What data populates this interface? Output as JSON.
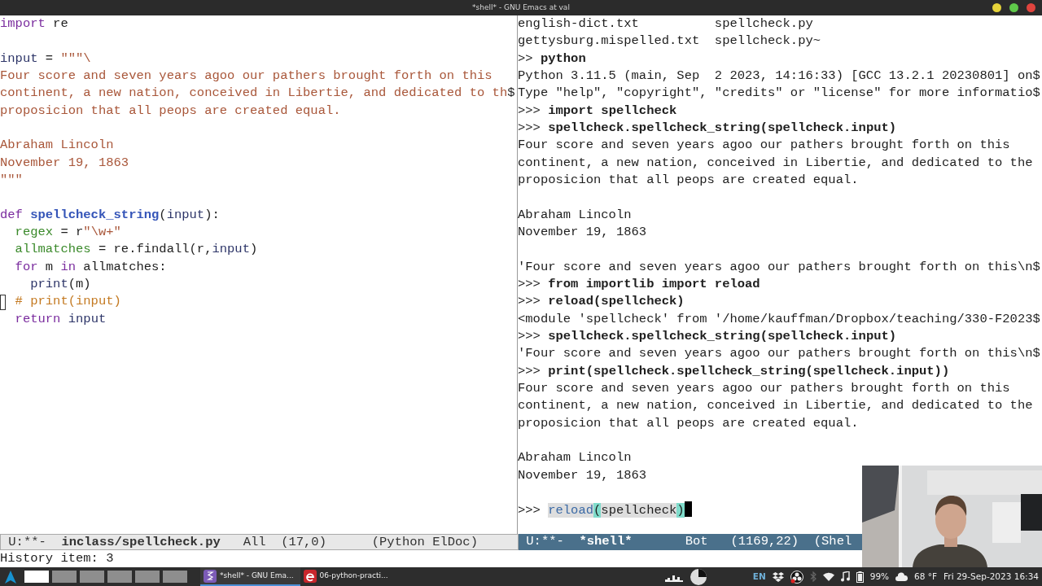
{
  "window": {
    "title": "*shell* - GNU Emacs at val",
    "buttons": [
      {
        "color": "#e6d33a"
      },
      {
        "color": "#5fc84a"
      },
      {
        "color": "#e0443e"
      }
    ]
  },
  "left_pane": {
    "lines": [
      {
        "kind": "code",
        "segments": [
          {
            "text": "import",
            "kind": "keyword"
          },
          {
            "text": " re",
            "kind": "plain"
          }
        ]
      },
      {
        "kind": "blank"
      },
      {
        "kind": "code",
        "segments": [
          {
            "text": "input",
            "kind": "name"
          },
          {
            "text": " = ",
            "kind": "plain"
          },
          {
            "text": "\"\"\"\\",
            "kind": "string"
          }
        ]
      },
      {
        "kind": "code",
        "segments": [
          {
            "text": "Four score and seven years agoo our pathers brought forth on this",
            "kind": "string"
          }
        ]
      },
      {
        "kind": "code",
        "segments": [
          {
            "text": "continent, a new nation, conceived in Libertie, and dedicated to th",
            "kind": "string"
          },
          {
            "text": "$",
            "kind": "plain"
          }
        ]
      },
      {
        "kind": "code",
        "segments": [
          {
            "text": "proposicion that all peops are created equal.",
            "kind": "string"
          }
        ]
      },
      {
        "kind": "blank"
      },
      {
        "kind": "code",
        "segments": [
          {
            "text": "Abraham Lincoln",
            "kind": "string"
          }
        ]
      },
      {
        "kind": "code",
        "segments": [
          {
            "text": "November 19, 1863",
            "kind": "string"
          }
        ]
      },
      {
        "kind": "code",
        "segments": [
          {
            "text": "\"\"\"",
            "kind": "string"
          }
        ]
      },
      {
        "kind": "blank"
      },
      {
        "kind": "code",
        "segments": [
          {
            "text": "def",
            "kind": "keyword"
          },
          {
            "text": " spellcheck_string",
            "kind": "func"
          },
          {
            "text": "(",
            "kind": "plain"
          },
          {
            "text": "input",
            "kind": "name"
          },
          {
            "text": "):",
            "kind": "plain"
          }
        ]
      },
      {
        "kind": "code",
        "segments": [
          {
            "text": "  regex",
            "kind": "var"
          },
          {
            "text": " = r",
            "kind": "plain"
          },
          {
            "text": "\"\\w+\"",
            "kind": "string"
          }
        ]
      },
      {
        "kind": "code",
        "segments": [
          {
            "text": "  allmatches",
            "kind": "var"
          },
          {
            "text": " = re.findall(r,",
            "kind": "plain"
          },
          {
            "text": "input",
            "kind": "name"
          },
          {
            "text": ")",
            "kind": "plain"
          }
        ]
      },
      {
        "kind": "code",
        "segments": [
          {
            "text": "  for",
            "kind": "keyword"
          },
          {
            "text": " m ",
            "kind": "plain"
          },
          {
            "text": "in",
            "kind": "keyword"
          },
          {
            "text": " allmatches:",
            "kind": "plain"
          }
        ]
      },
      {
        "kind": "code",
        "segments": [
          {
            "text": "    print",
            "kind": "name"
          },
          {
            "text": "(m)",
            "kind": "plain"
          }
        ]
      },
      {
        "kind": "code",
        "cursor": true,
        "segments": [
          {
            "text": "  # print(input)",
            "kind": "comment"
          }
        ]
      },
      {
        "kind": "code",
        "segments": [
          {
            "text": "  return",
            "kind": "keyword"
          },
          {
            "text": " input",
            "kind": "name"
          }
        ]
      }
    ]
  },
  "right_pane": {
    "lines": [
      {
        "kind": "code",
        "segments": [
          {
            "text": "english-dict.txt          spellcheck.py",
            "kind": "plain"
          }
        ]
      },
      {
        "kind": "code",
        "segments": [
          {
            "text": "gettysburg.mispelled.txt  spellcheck.py~",
            "kind": "plain"
          }
        ]
      },
      {
        "kind": "code",
        "segments": [
          {
            "text": ">> ",
            "kind": "plain"
          },
          {
            "text": "python",
            "kind": "bold"
          }
        ]
      },
      {
        "kind": "code",
        "segments": [
          {
            "text": "Python 3.11.5 (main, Sep  2 2023, 14:16:33) [GCC 13.2.1 20230801] on$",
            "kind": "plain"
          }
        ]
      },
      {
        "kind": "code",
        "segments": [
          {
            "text": "Type \"help\", \"copyright\", \"credits\" or \"license\" for more informatio$",
            "kind": "plain"
          }
        ]
      },
      {
        "kind": "code",
        "segments": [
          {
            "text": ">>> ",
            "kind": "plain"
          },
          {
            "text": "import spellcheck",
            "kind": "bold"
          }
        ]
      },
      {
        "kind": "code",
        "segments": [
          {
            "text": ">>> ",
            "kind": "plain"
          },
          {
            "text": "spellcheck.spellcheck_string(spellcheck.input)",
            "kind": "bold"
          }
        ]
      },
      {
        "kind": "code",
        "segments": [
          {
            "text": "Four score and seven years agoo our pathers brought forth on this",
            "kind": "plain"
          }
        ]
      },
      {
        "kind": "code",
        "segments": [
          {
            "text": "continent, a new nation, conceived in Libertie, and dedicated to the",
            "kind": "plain"
          }
        ]
      },
      {
        "kind": "code",
        "segments": [
          {
            "text": "proposicion that all peops are created equal.",
            "kind": "plain"
          }
        ]
      },
      {
        "kind": "blank"
      },
      {
        "kind": "code",
        "segments": [
          {
            "text": "Abraham Lincoln",
            "kind": "plain"
          }
        ]
      },
      {
        "kind": "code",
        "segments": [
          {
            "text": "November 19, 1863",
            "kind": "plain"
          }
        ]
      },
      {
        "kind": "blank"
      },
      {
        "kind": "code",
        "segments": [
          {
            "text": "'Four score and seven years agoo our pathers brought forth on this\\n$",
            "kind": "plain"
          }
        ]
      },
      {
        "kind": "code",
        "segments": [
          {
            "text": ">>> ",
            "kind": "plain"
          },
          {
            "text": "from importlib import reload",
            "kind": "bold"
          }
        ]
      },
      {
        "kind": "code",
        "segments": [
          {
            "text": ">>> ",
            "kind": "plain"
          },
          {
            "text": "reload(spellcheck)",
            "kind": "bold"
          }
        ]
      },
      {
        "kind": "code",
        "segments": [
          {
            "text": "<module 'spellcheck' from '/home/kauffman/Dropbox/teaching/330-F2023$",
            "kind": "plain"
          }
        ]
      },
      {
        "kind": "code",
        "segments": [
          {
            "text": ">>> ",
            "kind": "plain"
          },
          {
            "text": "spellcheck.spellcheck_string(spellcheck.input)",
            "kind": "bold"
          }
        ]
      },
      {
        "kind": "code",
        "segments": [
          {
            "text": "'Four score and seven years agoo our pathers brought forth on this\\n$",
            "kind": "plain"
          }
        ]
      },
      {
        "kind": "code",
        "segments": [
          {
            "text": ">>> ",
            "kind": "plain"
          },
          {
            "text": "print(spellcheck.spellcheck_string(spellcheck.input))",
            "kind": "bold"
          }
        ]
      },
      {
        "kind": "code",
        "segments": [
          {
            "text": "Four score and seven years agoo our pathers brought forth on this",
            "kind": "plain"
          }
        ]
      },
      {
        "kind": "code",
        "segments": [
          {
            "text": "continent, a new nation, conceived in Libertie, and dedicated to the",
            "kind": "plain"
          }
        ]
      },
      {
        "kind": "code",
        "segments": [
          {
            "text": "proposicion that all peops are created equal.",
            "kind": "plain"
          }
        ]
      },
      {
        "kind": "blank"
      },
      {
        "kind": "code",
        "segments": [
          {
            "text": "Abraham Lincoln",
            "kind": "plain"
          }
        ]
      },
      {
        "kind": "code",
        "segments": [
          {
            "text": "November 19, 1863",
            "kind": "plain"
          }
        ]
      },
      {
        "kind": "blank"
      },
      {
        "kind": "code",
        "cursor": true,
        "segments": [
          {
            "text": ">>> ",
            "kind": "plain"
          },
          {
            "text": "reload",
            "kind": "region_func"
          },
          {
            "text": "(",
            "kind": "region_paren"
          },
          {
            "text": "spellcheck",
            "kind": "region"
          },
          {
            "text": ")",
            "kind": "region_paren"
          }
        ]
      }
    ]
  },
  "mode_lines": [
    {
      "selected": false,
      "status": "U:**-",
      "buffer": "inclass/spellcheck.py",
      "position": "All",
      "cursor": "(17,0)",
      "modes": "(Python ElDoc)"
    },
    {
      "selected": true,
      "status": "U:**-",
      "buffer": "*shell*",
      "position": "Bot",
      "cursor": "(1169,22)",
      "modes": "(Shel"
    }
  ],
  "minibuffer": "History item: 3",
  "taskbar": {
    "workspaces": [
      {
        "selected": true
      },
      {
        "selected": false
      },
      {
        "selected": false
      },
      {
        "selected": false
      },
      {
        "selected": false
      },
      {
        "selected": false
      }
    ],
    "tasks": [
      {
        "kind": "editor",
        "label": "*shell* - GNU Ema...",
        "selected": true
      },
      {
        "kind": "viewer",
        "label": "06-python-practi...",
        "selected": false
      }
    ],
    "keyboard_layout": "EN",
    "battery": "99%",
    "weather": "68 °F",
    "clock": "Fri 29-Sep-2023 16:34"
  }
}
